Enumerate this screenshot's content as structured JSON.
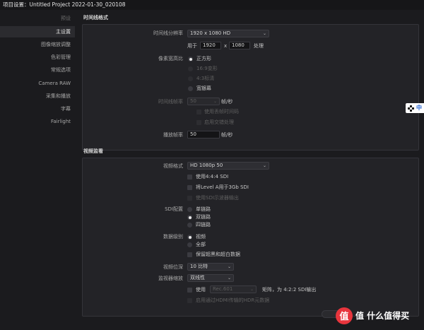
{
  "window": {
    "title": "项目设置：Untitled Project 2022-01-30_020108"
  },
  "sidebar": {
    "items": [
      {
        "label": "预设"
      },
      {
        "label": "主设置"
      },
      {
        "label": "图像缩放调整"
      },
      {
        "label": "色彩管理"
      },
      {
        "label": "常规选项"
      },
      {
        "label": "Camera RAW"
      },
      {
        "label": "采集和播放"
      },
      {
        "label": "字幕"
      },
      {
        "label": "Fairlight"
      }
    ],
    "active_index": 1
  },
  "timeline_format": {
    "section_title": "时间线格式",
    "resolution_label": "时间线分辨率",
    "resolution_value": "1920 x 1080 HD",
    "for_label": "用于",
    "width": "1920",
    "x_sep": "x",
    "height": "1080",
    "process_label": "处理",
    "par_label": "像素宽高比",
    "par_options": [
      "正方形",
      "16:9变形",
      "4:3标清",
      "宽银幕"
    ],
    "timeline_fps_label": "时间线帧率",
    "timeline_fps_value": "50",
    "fps_unit": "帧/秒",
    "drop_frame_label": "使用丢帧时间码",
    "interlace_label": "启用交错处理",
    "playback_fps_label": "播放帧率",
    "playback_fps_value": "50",
    "playback_fps_unit": "帧/秒"
  },
  "video_monitoring": {
    "section_title": "视频监看",
    "video_format_label": "视频格式",
    "video_format_value": "HD 1080p 50",
    "use_444_sdi": "使用4:4:4 SDI",
    "level_a_3g": "将Level A用于3Gb SDI",
    "sdi_scope_output": "使用SDI示波器输出",
    "sdi_config_label": "SDI配置",
    "sdi_options": [
      "单链路",
      "双链路",
      "四链路"
    ],
    "data_level_label": "数据级别",
    "data_level_options": [
      "视频",
      "全部"
    ],
    "retain_sub_black": "保留超黑和超白数据",
    "bit_depth_label": "视频位深",
    "bit_depth_value": "10 比特",
    "monitor_scale_label": "监视器缩放",
    "monitor_scale_value": "双线性",
    "use_label": "使用",
    "rec_value": "Rec.601",
    "matrix_label": "矩阵，为 4:2:2 SDI输出",
    "hdmi_hdr_label": "启用通过HDMI传输的HDR元数据"
  },
  "overlay": {
    "zh_label": "中",
    "watermark_text": "值 什么值得买"
  }
}
